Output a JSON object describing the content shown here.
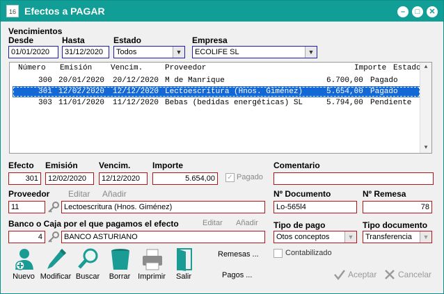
{
  "window": {
    "title": "Efectos a PAGAR",
    "icon_text": "16"
  },
  "filters": {
    "section_label": "Vencimientos",
    "desde_label": "Desde",
    "desde_value": "01/01/2020",
    "hasta_label": "Hasta",
    "hasta_value": "31/12/2020",
    "estado_label": "Estado",
    "estado_value": "Todos",
    "empresa_label": "Empresa",
    "empresa_value": "ECOLIFE SL"
  },
  "list": {
    "headers": [
      "Número",
      "Emisión",
      "Vencim.",
      "Proveedor",
      "Importe",
      "Estado"
    ],
    "rows": [
      {
        "numero": "300",
        "emision": "20/01/2020",
        "vencim": "20/12/2020",
        "proveedor": "M de Manrique",
        "importe": "6.700,00",
        "estado": "Pagado"
      },
      {
        "numero": "301",
        "emision": "12/02/2020",
        "vencim": "12/12/2020",
        "proveedor": "Lectoescritura (Hnos. Giménez)",
        "importe": "5.654,00",
        "estado": "Pagado"
      },
      {
        "numero": "303",
        "emision": "11/01/2020",
        "vencim": "11/12/2020",
        "proveedor": "Bebas (bedidas energéticas) SL",
        "importe": "5.794,00",
        "estado": "Pendiente"
      }
    ]
  },
  "detail": {
    "efecto_label": "Efecto",
    "efecto_value": "301",
    "emision_label": "Emisión",
    "emision_value": "12/02/2020",
    "vencim_label": "Vencim.",
    "vencim_value": "12/12/2020",
    "importe_label": "Importe",
    "importe_value": "5.654,00",
    "pagado_label": "Pagado",
    "comentario_label": "Comentario",
    "comentario_value": "",
    "proveedor_label": "Proveedor",
    "editar_label": "Editar",
    "anadir_label": "Añadir",
    "proveedor_code": "11",
    "proveedor_name": "Lectoescritura (Hnos. Giménez)",
    "ndoc_label": "Nº Documento",
    "ndoc_value": "Lo-565l4",
    "nremesa_label": "Nº Remesa",
    "nremesa_value": "78",
    "banco_label": "Banco o Caja por el que pagamos el efecto",
    "banco_code": "4",
    "banco_name": "BANCO ASTURIANO",
    "tipopago_label": "Tipo de pago",
    "tipopago_value": "Otos conceptos",
    "tipodoc_label": "Tipo documento",
    "tipodoc_value": "Transferencia",
    "contabilizado_label": "Contabilizado"
  },
  "toolbar": {
    "nuevo": "Nuevo",
    "modificar": "Modificar",
    "buscar": "Buscar",
    "borrar": "Borrar",
    "imprimir": "Imprimir",
    "salir": "Salir",
    "remesas": "Remesas ...",
    "pagos": "Pagos ...",
    "aceptar": "Aceptar",
    "cancelar": "Cancelar"
  },
  "colors": {
    "titlebar": "#109e96",
    "field_border": "#b31414",
    "selection": "#1468d6"
  }
}
